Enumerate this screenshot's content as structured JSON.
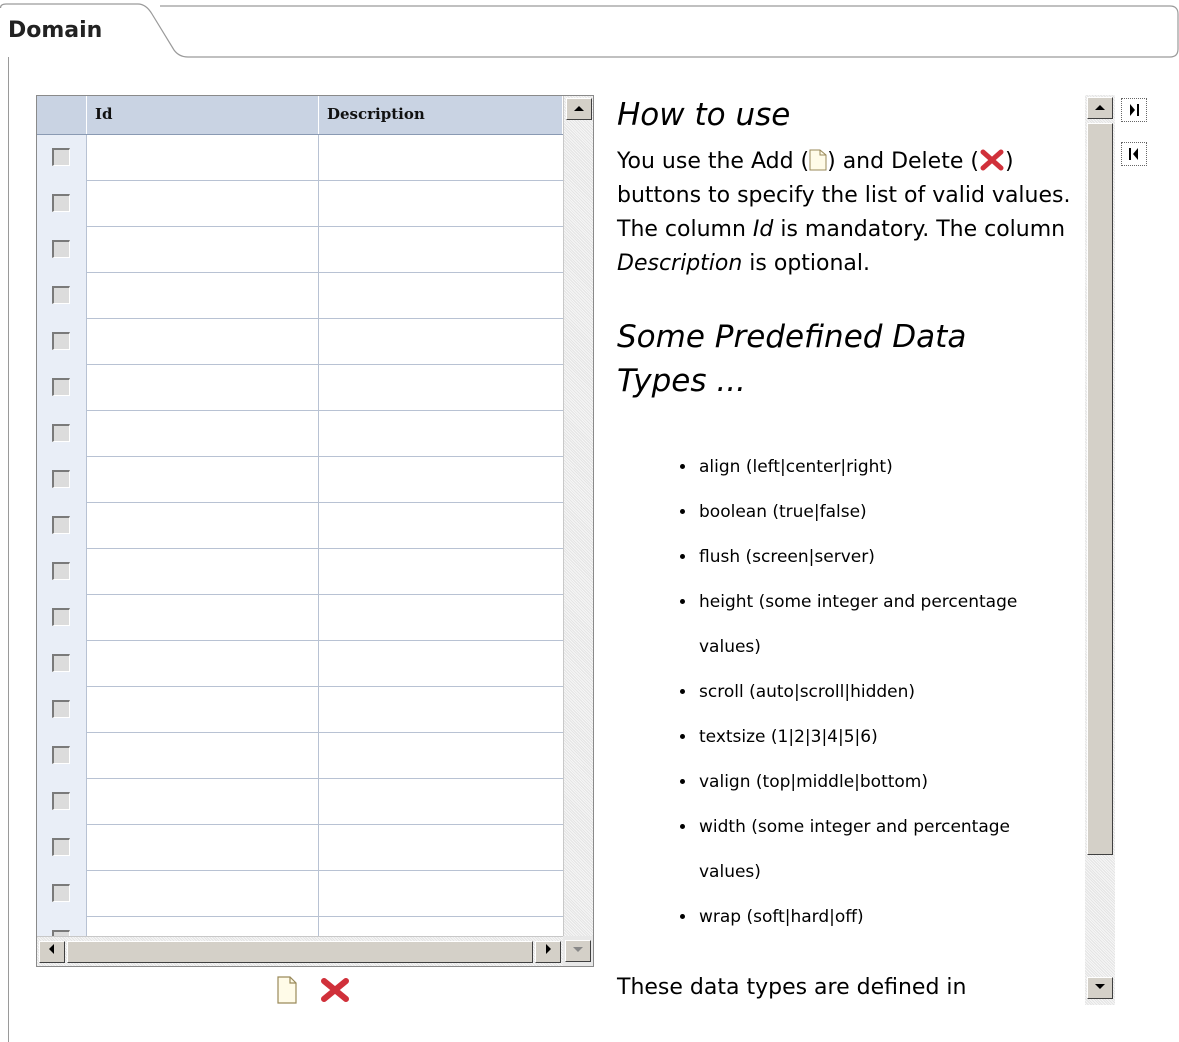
{
  "tab": {
    "label": "Domain"
  },
  "grid": {
    "columns": [
      "Id",
      "Description"
    ],
    "rows": [
      {
        "id": "",
        "description": ""
      },
      {
        "id": "",
        "description": ""
      },
      {
        "id": "",
        "description": ""
      },
      {
        "id": "",
        "description": ""
      },
      {
        "id": "",
        "description": ""
      },
      {
        "id": "",
        "description": ""
      },
      {
        "id": "",
        "description": ""
      },
      {
        "id": "",
        "description": ""
      },
      {
        "id": "",
        "description": ""
      },
      {
        "id": "",
        "description": ""
      },
      {
        "id": "",
        "description": ""
      },
      {
        "id": "",
        "description": ""
      },
      {
        "id": "",
        "description": ""
      },
      {
        "id": "",
        "description": ""
      },
      {
        "id": "",
        "description": ""
      },
      {
        "id": "",
        "description": ""
      },
      {
        "id": "",
        "description": ""
      },
      {
        "id": "",
        "description": ""
      }
    ]
  },
  "help": {
    "title": "How to use",
    "p1_a": "You use the Add (",
    "p1_b": ") and Delete (",
    "p1_c": ") buttons to specify the list of valid values. The column ",
    "p1_id": "Id",
    "p1_d": " is mandatory. The column ",
    "p1_desc": "Description",
    "p1_e": " is optional.",
    "subtitle": "Some Predefined Data Types ...",
    "items": [
      "align (left|center|right)",
      "boolean (true|false)",
      "flush (screen|server)",
      "height (some integer and percentage values)",
      "scroll (auto|scroll|hidden)",
      "textsize (1|2|3|4|5|6)",
      "valign (top|middle|bottom)",
      "width (some integer and percentage values)",
      "wrap (soft|hard|off)"
    ],
    "p2": "These data types are defined in"
  },
  "icons": {
    "add": "new-document-icon",
    "delete": "red-x-icon",
    "collapse": "collapse-panel-icon",
    "expand": "expand-panel-icon"
  },
  "colors": {
    "header_bg": "#c9d3e3",
    "selector_bg": "#e9eef7",
    "delete_red": "#d0303a"
  }
}
